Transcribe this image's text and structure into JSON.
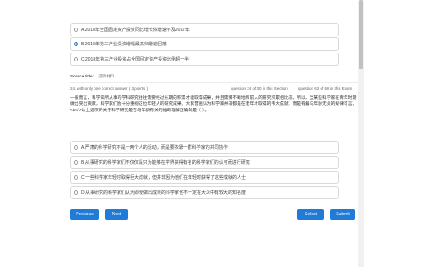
{
  "prev_options": [
    {
      "label": "A.2018年全国固定资产投资同比增长依增速不及2017年",
      "selected": false
    },
    {
      "label": "B.2018年第三产业投资增幅最高归增速回落",
      "selected": true
    },
    {
      "label": "C.2018年第三产业投资占全国固定资产投资比例超一半",
      "selected": false
    }
  ],
  "source": {
    "label": "Source title:",
    "value": "选项材料"
  },
  "question": {
    "meta_left": "24. with only one correct answer ( 3 points )",
    "meta_mid": "question 24 of 30 in this Section",
    "meta_right": "question 62 of 68 in this Exam",
    "text": "一般而言，科学家所从事的学科研究往往需要经过长期的积累才能取得成果，并且需要不断地和前人的研究积累相比较。所以，当某些科学家在青年时期做出突出贡献，科学家们会十分重视这位年轻人的研究成果，大家普遍认为科学家并非都是在老年才取得的伟大成就，而是有着与年龄无关的规律可言。<br />以上选项的关于科学研究是否与年龄有关的推断理解正确的是（    ）。"
  },
  "options": [
    {
      "label": "A.严肃的科学研究不是一两个人的活动，而是要依靠一群科学家的共同协作"
    },
    {
      "label": "B.从事研究的科学家们不仅仅是只为能够在学界获得有名的科学家们的认可而进行研究"
    },
    {
      "label": "C.一些科学家年轻时取得巨大成就，但并非因为他们在年轻时获得了这些成就的人士"
    },
    {
      "label": "D.从事研究的科学家们认为即使做出成果的科学家也不一定在大众中有较大的知名度"
    }
  ],
  "buttons": {
    "previous": "Previous",
    "next": "Next",
    "select": "Select",
    "submit": "Submit"
  }
}
